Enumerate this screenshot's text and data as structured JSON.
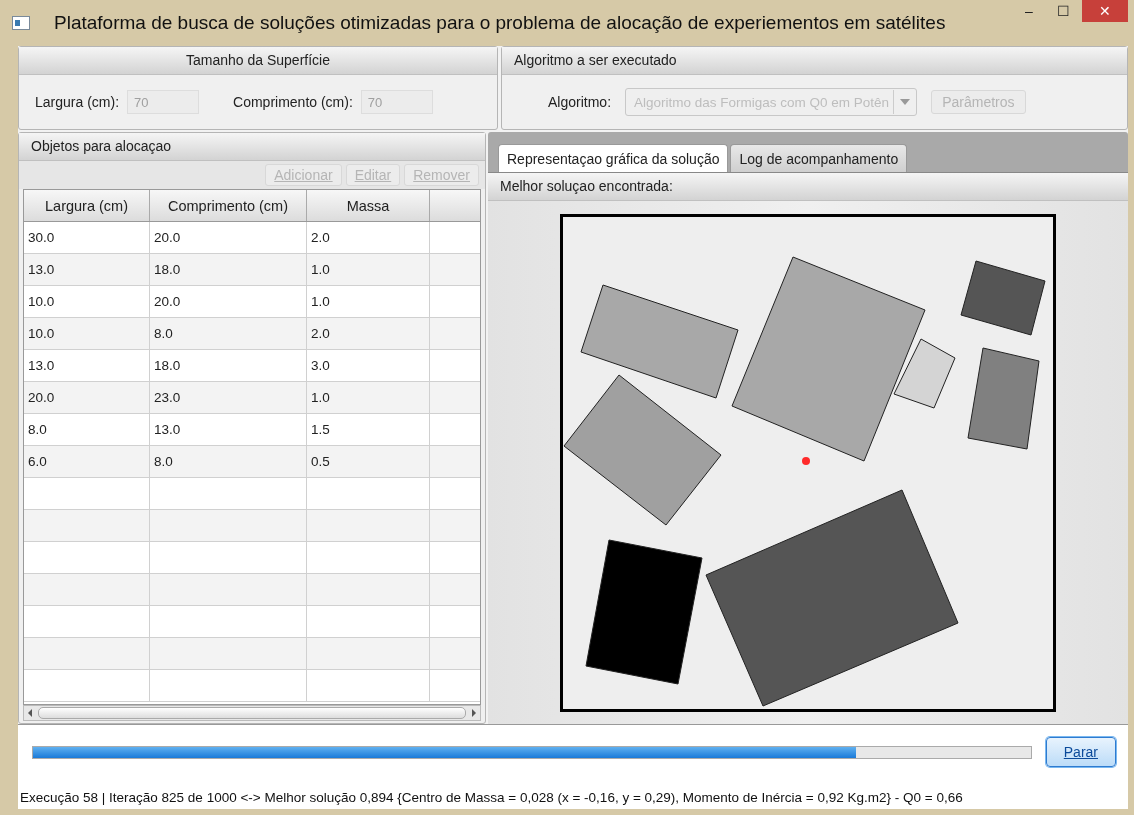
{
  "window": {
    "title": "Plataforma de busca de soluções otimizadas para o problema de alocação de experiementos em satélites",
    "controls": [
      "–",
      "☐",
      "✕"
    ]
  },
  "surface": {
    "title": "Tamanho da Superfície",
    "fields": [
      {
        "label": "Largura (cm):",
        "value": "70",
        "disabled": true
      },
      {
        "label": "Comprimento (cm):",
        "value": "70",
        "disabled": true
      }
    ]
  },
  "algorithm": {
    "title": "Algoritmo a ser executado",
    "label": "Algoritmo:",
    "value": "Algoritmo das Formigas com Q0 em Potên",
    "disabled": true,
    "button": {
      "label": "Parâmetros",
      "disabled": true
    }
  },
  "objects": {
    "title": "Objetos para alocaçao",
    "buttons": [
      {
        "label": "Adicionar",
        "disabled": true
      },
      {
        "label": "Editar",
        "disabled": true
      },
      {
        "label": "Remover",
        "disabled": true
      }
    ],
    "table": {
      "columns": [
        "Largura (cm)",
        "Comprimento (cm)",
        "Massa"
      ],
      "rows": [
        [
          "30.0",
          "20.0",
          "2.0"
        ],
        [
          "13.0",
          "18.0",
          "1.0"
        ],
        [
          "10.0",
          "20.0",
          "1.0"
        ],
        [
          "10.0",
          "8.0",
          "2.0"
        ],
        [
          "13.0",
          "18.0",
          "3.0"
        ],
        [
          "20.0",
          "23.0",
          "1.0"
        ],
        [
          "8.0",
          "13.0",
          "1.5"
        ],
        [
          "6.0",
          "8.0",
          "0.5"
        ]
      ]
    }
  },
  "tabs": [
    {
      "label": "Representaçao gráfica da solução",
      "selected": true
    },
    {
      "label": "Log de acompanhamento",
      "selected": false
    }
  ],
  "solution": {
    "title": "Melhor soluçao encontrada:"
  },
  "progress": {
    "level": 0.825
  },
  "stop_button": {
    "label": "Parar",
    "disabled": false
  },
  "status_bar": "Execução 58 | Iteração 825 de 1000 <-> Melhor solução 0,894 {Centro de Massa = 0,028 (x = -0,16, y = 0,29), Momento de Inércia = 0,92 Kg.m2} - Q0 = 0,66"
}
